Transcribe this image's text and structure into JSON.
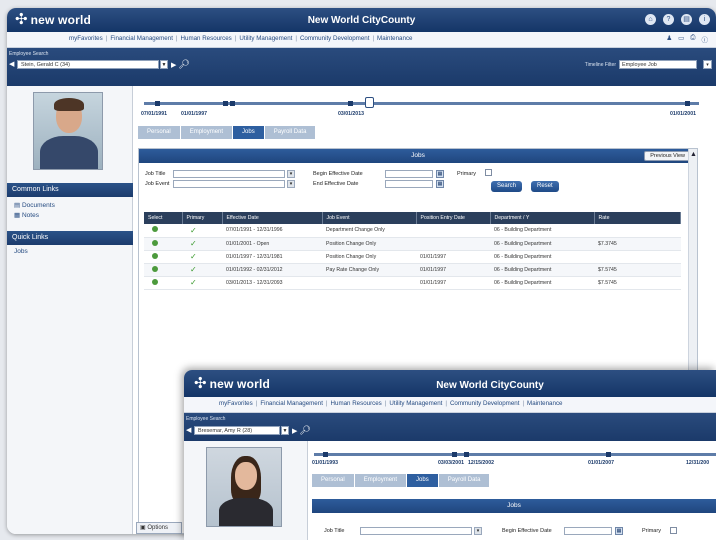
{
  "app": {
    "logo_text": "new world",
    "logo_subtext": "",
    "title": "New World CityCounty"
  },
  "menu": {
    "items": [
      "myFavorites",
      "Financial Management",
      "Human Resources",
      "Utility Management",
      "Community Development",
      "Maintenance"
    ],
    "right_icons": [
      "home-icon",
      "help-icon",
      "print-icon",
      "info-icon"
    ]
  },
  "employee_bar": {
    "label": "Employee Search",
    "selected": "Stein, Gerald C (34)",
    "timeline_filter_label": "Timeline Filter",
    "timeline_filter_value": "Employee Job"
  },
  "sidebar": {
    "common_links_header": "Common Links",
    "common_links": [
      "Documents",
      "Notes"
    ],
    "quick_links_header": "Quick Links",
    "quick_links": [
      "Jobs"
    ],
    "options_label": "Options"
  },
  "timeline": {
    "dates_left": [
      "07/01/1991",
      "01/01/1997"
    ],
    "date_mid": "03/01/2013",
    "date_right": "01/01/2001"
  },
  "tabs": [
    "Personal",
    "Employment",
    "Jobs",
    "Payroll Data"
  ],
  "active_tab": "Jobs",
  "panel": {
    "title": "Jobs",
    "prev_view_label": "Previous View",
    "job_title_label": "Job Title",
    "job_event_label": "Job Event",
    "begin_date_label": "Begin Effective Date",
    "end_date_label": "End Effective Date",
    "primary_label": "Primary",
    "search_label": "Search",
    "reset_label": "Reset"
  },
  "grid": {
    "columns": [
      "Select",
      "Primary",
      "Effective Date",
      "Job Event",
      "Position Entry Date",
      "Department / Y",
      "Rate"
    ],
    "rows": [
      {
        "effective": "07/01/1991 - 12/31/1996",
        "event": "Department Change Only",
        "entry": "",
        "dept": "06 - Building Department",
        "rate": ""
      },
      {
        "effective": "01/01/2001 - Open",
        "event": "Position Change Only",
        "entry": "",
        "dept": "06 - Building Department",
        "rate": "$7.3745"
      },
      {
        "effective": "01/01/1997 - 12/31/1981",
        "event": "Position Change Only",
        "entry": "01/01/1997",
        "dept": "06 - Building Department",
        "rate": ""
      },
      {
        "effective": "01/01/1992 - 02/31/2012",
        "event": "Pay Rate Change Only",
        "entry": "01/01/1997",
        "dept": "06 - Building Department",
        "rate": "$7.5745"
      },
      {
        "effective": "03/01/2013 - 12/31/2093",
        "event": "",
        "entry": "01/01/1997",
        "dept": "06 - Building Department",
        "rate": "$7.5745"
      }
    ]
  },
  "second_window": {
    "logo_text": "new world",
    "title": "New World CityCounty",
    "menu": [
      "myFavorites",
      "Financial Management",
      "Human Resources",
      "Utility Management",
      "Community Development",
      "Maintenance"
    ],
    "employee_label": "Employee Search",
    "selected": "Bresemar, Amy R (28)",
    "timeline_dates": [
      "01/01/1993",
      "03/03/2001",
      "12/15/2002",
      "01/01/2007",
      "12/31/200"
    ],
    "tabs": [
      "Personal",
      "Employment",
      "Jobs",
      "Payroll Data"
    ],
    "panel_title": "Jobs",
    "job_title_label": "Job Title",
    "begin_date_label": "Begin Effective Date",
    "primary_label": "Primary"
  },
  "colors": {
    "header_blue": "#1b3a6a",
    "accent_blue": "#2e5fa0",
    "check_green": "#3b9a2e"
  }
}
